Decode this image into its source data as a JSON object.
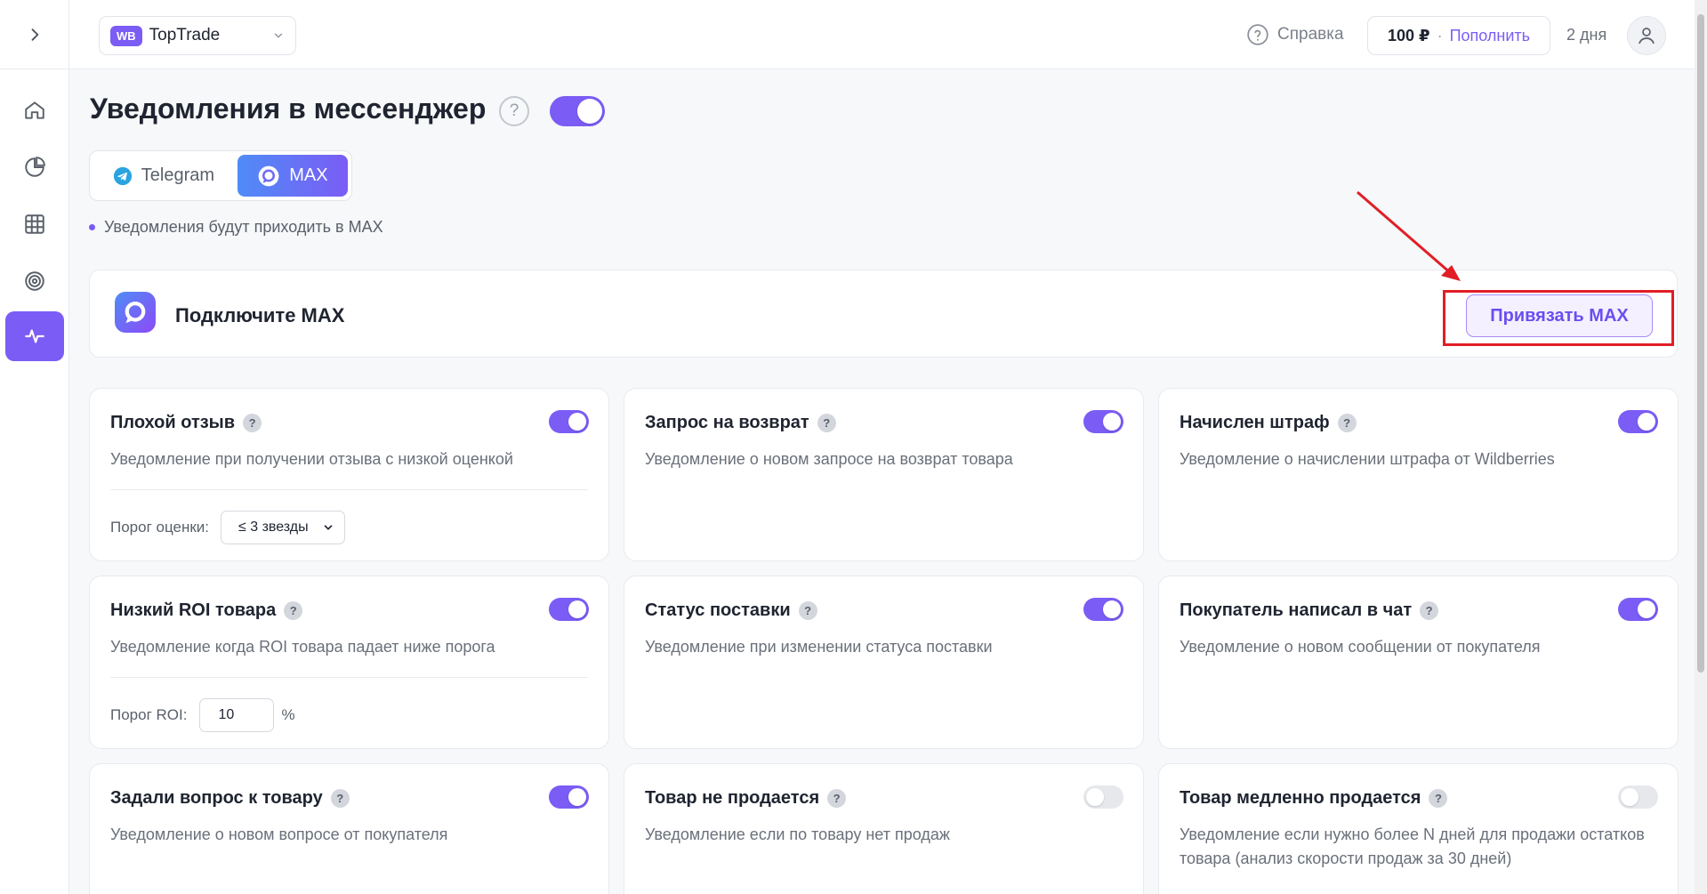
{
  "header": {
    "shop_badge": "WB",
    "shop_name": "TopTrade",
    "help_label": "Справка",
    "balance_amount": "100 ₽",
    "balance_separator": "·",
    "topup_label": "Пополнить",
    "days_left": "2 дня"
  },
  "sidebar": {
    "items": [
      {
        "icon": "home-icon",
        "active": false
      },
      {
        "icon": "pie-chart-icon",
        "active": false
      },
      {
        "icon": "grid-icon",
        "active": false
      },
      {
        "icon": "target-icon",
        "active": false
      },
      {
        "icon": "activity-icon",
        "active": true
      }
    ]
  },
  "page": {
    "title": "Уведомления в мессенджер",
    "title_help": "?",
    "enabled": true
  },
  "tabs": [
    {
      "label": "Telegram",
      "active": false
    },
    {
      "label": "MAX",
      "active": true
    }
  ],
  "hint": "Уведомления будут приходить в MAX",
  "connect": {
    "title": "Подключите MAX",
    "button_label": "Привязать MAX"
  },
  "colors": {
    "accent": "#7b5cf5",
    "highlight_frame": "#e11e26",
    "toggle_off": "#e6e8ec"
  },
  "cards": [
    {
      "title": "Плохой отзыв",
      "desc": "Уведомление при получении отзыва с низкой оценкой",
      "enabled": true,
      "field_label": "Порог оценки:",
      "field_value": "≤ 3 звезды"
    },
    {
      "title": "Запрос на возврат",
      "desc": "Уведомление о новом запросе на возврат товара",
      "enabled": true
    },
    {
      "title": "Начислен штраф",
      "desc": "Уведомление о начислении штрафа от Wildberries",
      "enabled": true
    },
    {
      "title": "Низкий ROI товара",
      "desc": "Уведомление когда ROI товара падает ниже порога",
      "enabled": true,
      "field_label": "Порог ROI:",
      "field_value": "10",
      "field_unit": "%"
    },
    {
      "title": "Статус поставки",
      "desc": "Уведомление при изменении статуса поставки",
      "enabled": true
    },
    {
      "title": "Покупатель написал в чат",
      "desc": "Уведомление о новом сообщении от покупателя",
      "enabled": true
    },
    {
      "title": "Задали вопрос к товару",
      "desc": "Уведомление о новом вопросе от покупателя",
      "enabled": true
    },
    {
      "title": "Товар не продается",
      "desc": "Уведомление если по товару нет продаж",
      "enabled": false
    },
    {
      "title": "Товар медленно продается",
      "desc": "Уведомление если нужно более N дней для продажи остатков товара (анализ скорости продаж за 30 дней)",
      "enabled": false
    }
  ]
}
